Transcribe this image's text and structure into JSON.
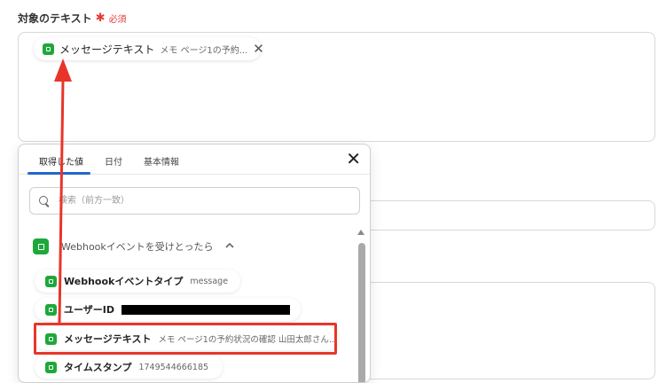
{
  "field": {
    "label": "対象のテキスト",
    "required_mark": "✱",
    "required_text": "必須"
  },
  "chip_main": {
    "name": "メッセージテキスト",
    "value": "メモ ページ1の予約...",
    "close": "✕"
  },
  "panel": {
    "tabs": [
      {
        "label": "取得した値"
      },
      {
        "label": "日付"
      },
      {
        "label": "基本情報"
      }
    ],
    "close": "✕",
    "search": {
      "placeholder": "検索（前方一致）"
    },
    "section": {
      "title": "Webhookイベントを受けとったら",
      "chevron": "^"
    },
    "items": [
      {
        "name": "Webhookイベントタイプ",
        "value": "message"
      },
      {
        "name": "ユーザーID",
        "value": ""
      },
      {
        "name": "メッセージテキスト",
        "value": "メモ ページ1の予約状況の確認 山田太郎さん..."
      },
      {
        "name": "タイムスタンプ",
        "value": "1749544666185"
      }
    ]
  },
  "colors": {
    "accent": "#2368c8",
    "line_green": "#1ea83a",
    "annotation_red": "#e8352a",
    "required_red": "#e53935"
  },
  "icons": {
    "line": "line-app-icon",
    "close": "close-icon",
    "search": "search-icon",
    "chevron": "chevron-up-icon"
  }
}
